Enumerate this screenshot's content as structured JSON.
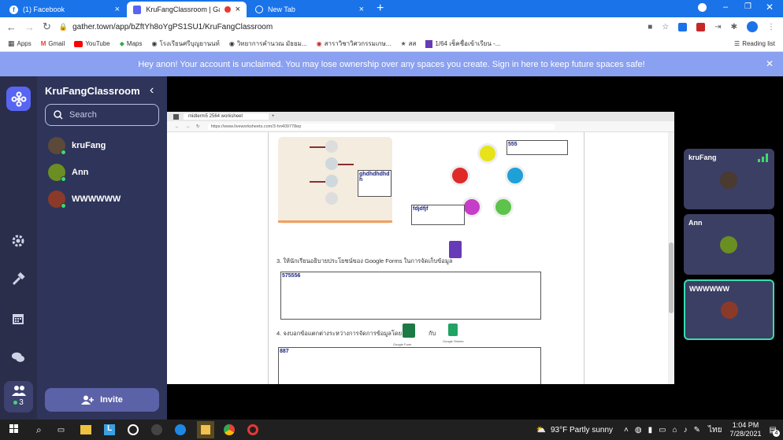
{
  "tabs": [
    {
      "label": "(1) Facebook"
    },
    {
      "label": "KruFangClassroom | Gather"
    },
    {
      "label": "New Tab"
    }
  ],
  "address": "gather.town/app/bZftYh8oYgPS1SU1/KruFangClassroom",
  "bookmarks": [
    "Apps",
    "Gmail",
    "YouTube",
    "Maps",
    "โรงเรียนศรีบุญยานนท์",
    "วิทยาการคำนวณ มัธยม...",
    "สาราวิชาวิศวกรรมเกษ...",
    "สส",
    "1/64 เช็คชื่อเข้าเรียน -..."
  ],
  "reading_list": "Reading list",
  "banner": "Hey anon! Your account is unclaimed. You may lose ownership over any spaces you create. Sign in here to keep future spaces safe!",
  "sidebar": {
    "title": "KruFangClassroom",
    "search_placeholder": "Search",
    "members": [
      {
        "name": "kruFang"
      },
      {
        "name": "Ann"
      },
      {
        "name": "WWWWWW"
      }
    ],
    "invite": "Invite",
    "people_count": "3"
  },
  "shared": {
    "tab": "midterm5 2564 worksheet",
    "url": "https://www.liveworksheets.com/3-hn409778ep",
    "fields": {
      "f1": "555",
      "f2": "ghdhdhdhdh",
      "f3": "fdjdfjf",
      "f4": "575556",
      "f5": "887"
    },
    "q3": "3. ให้นักเรียนอธิบายประโยชน์ของ Google Forms ในการจัดเก็บข้อมูล",
    "q4": "4. จงบอกข้อแตกต่างระหว่างการจัดการข้อมูลโดย",
    "gforms": "Google Form",
    "with": "กับ",
    "gsheets": "Google Sheets"
  },
  "tiles": [
    {
      "name": "kruFang"
    },
    {
      "name": "Ann"
    },
    {
      "name": "WWWWWW"
    }
  ],
  "taskbar": {
    "weather": "93°F  Partly sunny",
    "lang": "ไทย",
    "time": "1:04 PM",
    "date": "7/28/2021",
    "notif": "4"
  }
}
